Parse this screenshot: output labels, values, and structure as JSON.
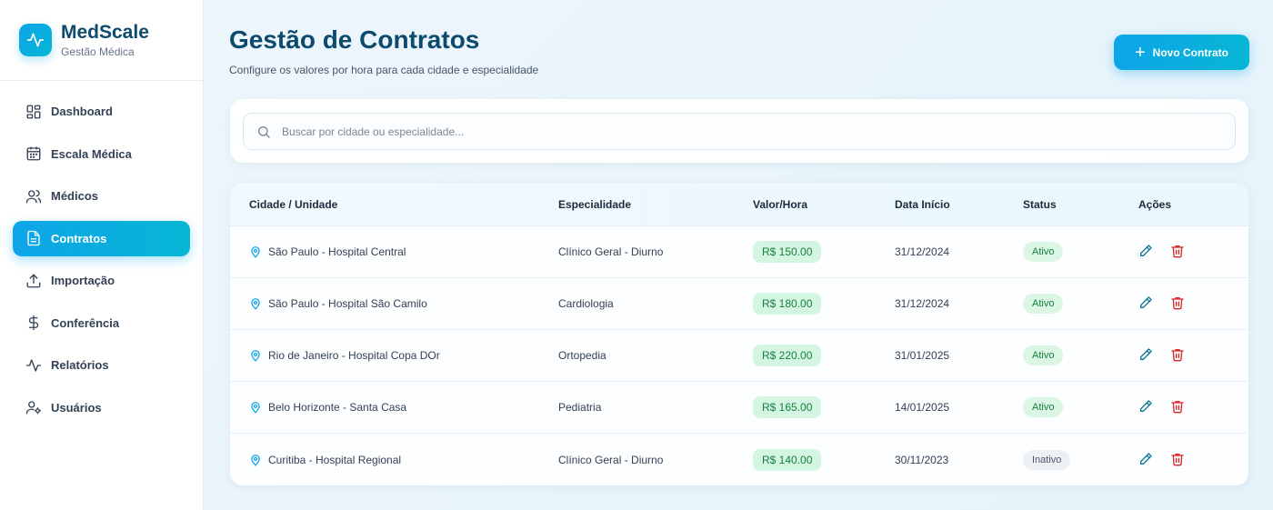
{
  "brand": {
    "name": "MedScale",
    "subtitle": "Gestão Médica"
  },
  "nav": [
    {
      "label": "Dashboard",
      "icon": "dashboard-icon"
    },
    {
      "label": "Escala Médica",
      "icon": "calendar-icon"
    },
    {
      "label": "Médicos",
      "icon": "users-icon"
    },
    {
      "label": "Contratos",
      "icon": "file-icon",
      "active": true
    },
    {
      "label": "Importação",
      "icon": "upload-icon"
    },
    {
      "label": "Conferência",
      "icon": "dollar-icon"
    },
    {
      "label": "Relatórios",
      "icon": "activity-icon"
    },
    {
      "label": "Usuários",
      "icon": "user-settings-icon"
    }
  ],
  "page": {
    "title": "Gestão de Contratos",
    "subtitle": "Configure os valores por hora para cada cidade e especialidade",
    "new_button": "Novo Contrato"
  },
  "search": {
    "placeholder": "Buscar por cidade ou especialidade..."
  },
  "table": {
    "headers": {
      "city": "Cidade / Unidade",
      "specialty": "Especialidade",
      "value": "Valor/Hora",
      "date": "Data Início",
      "status": "Status",
      "actions": "Ações"
    },
    "rows": [
      {
        "city": "São Paulo - Hospital Central",
        "specialty": "Clínico Geral - Diurno",
        "value": "R$ 150.00",
        "date": "31/12/2024",
        "status": "Ativo"
      },
      {
        "city": "São Paulo - Hospital São Camilo",
        "specialty": "Cardiologia",
        "value": "R$ 180.00",
        "date": "31/12/2024",
        "status": "Ativo"
      },
      {
        "city": "Rio de Janeiro - Hospital Copa DOr",
        "specialty": "Ortopedia",
        "value": "R$ 220.00",
        "date": "31/01/2025",
        "status": "Ativo"
      },
      {
        "city": "Belo Horizonte - Santa Casa",
        "specialty": "Pediatria",
        "value": "R$ 165.00",
        "date": "14/01/2025",
        "status": "Ativo"
      },
      {
        "city": "Curitiba - Hospital Regional",
        "specialty": "Clínico Geral - Diurno",
        "value": "R$ 140.00",
        "date": "30/11/2023",
        "status": "Inativo"
      }
    ]
  },
  "colors": {
    "accent": "#0ea5e9",
    "accent2": "#06b6d4",
    "title": "#0c4a6e",
    "danger": "#dc2626",
    "success": "#15803d"
  }
}
